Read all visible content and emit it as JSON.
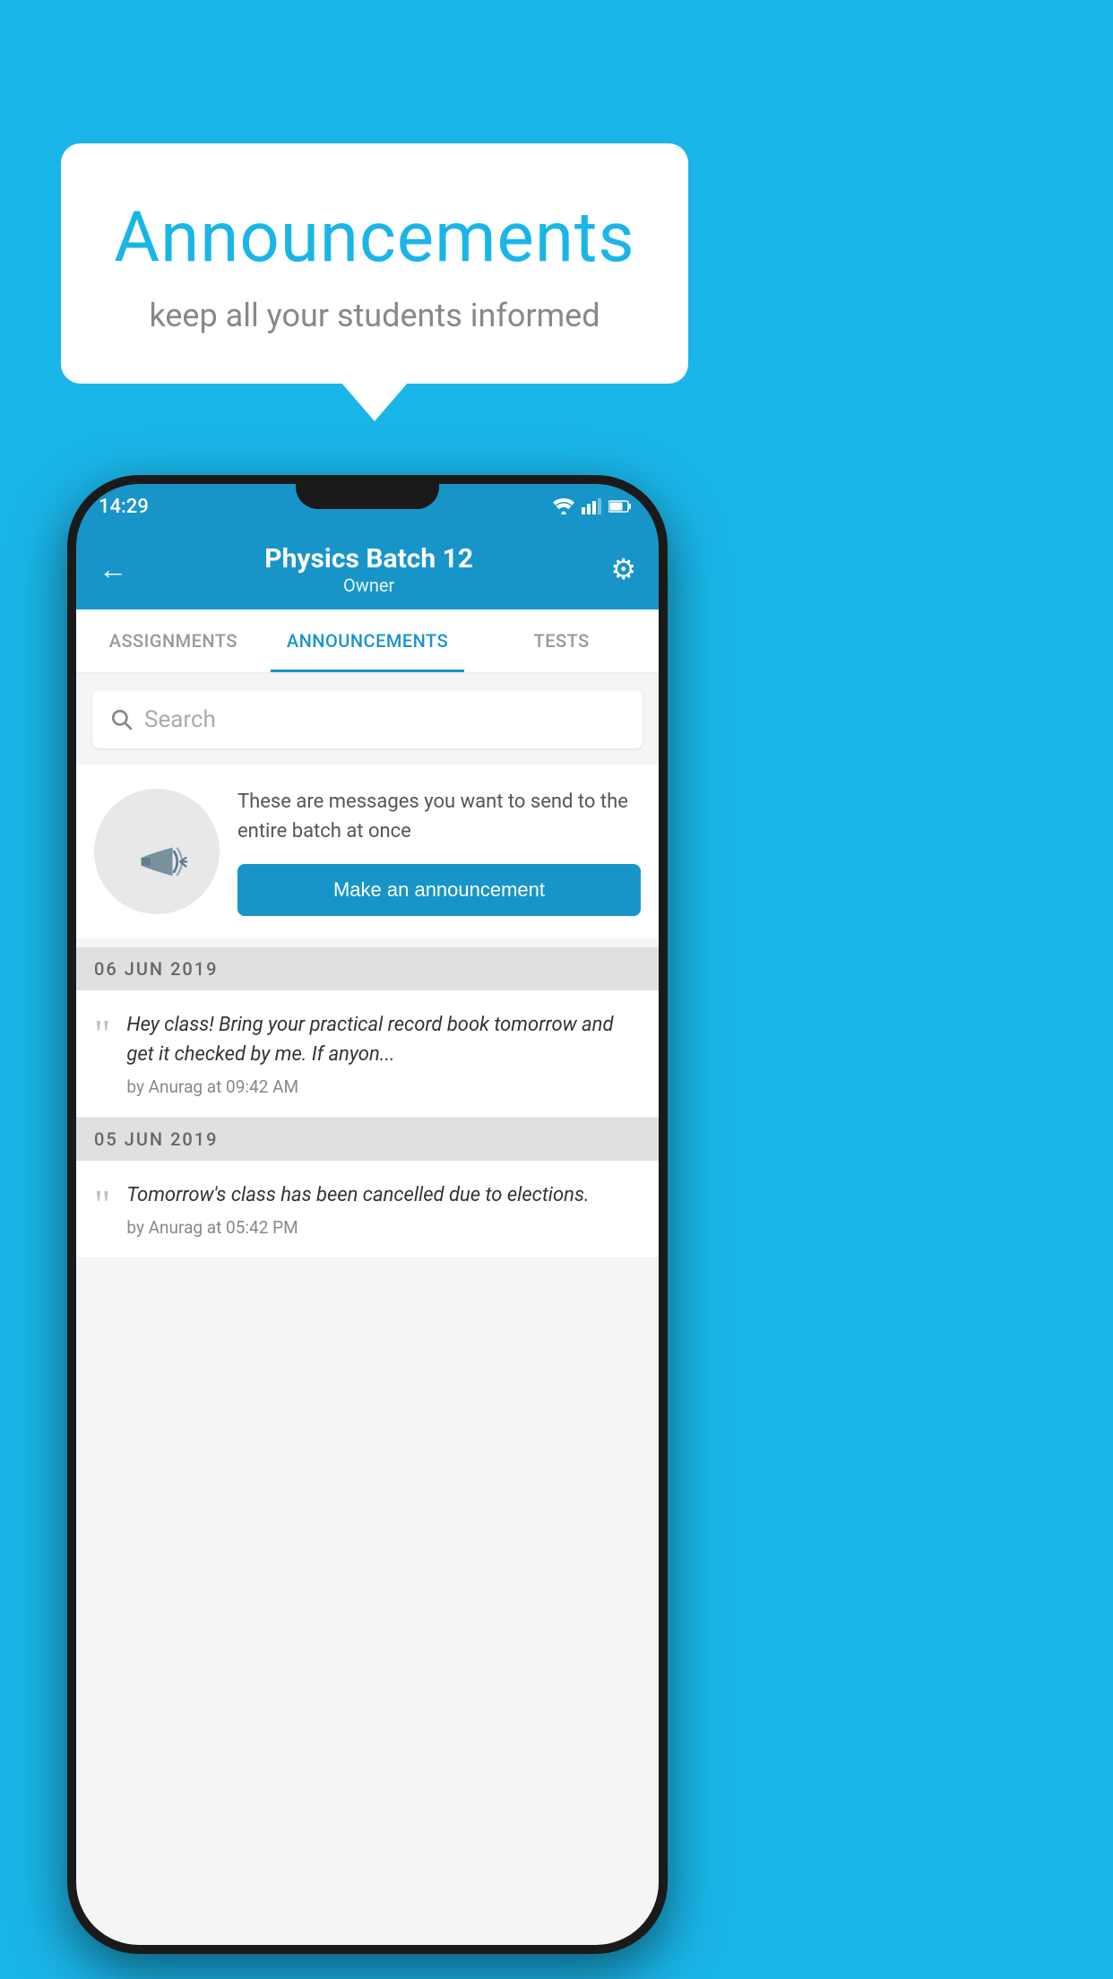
{
  "background_color": "#1ab5e8",
  "speech_bubble": {
    "title": "Announcements",
    "subtitle": "keep all your students informed"
  },
  "phone": {
    "status_bar": {
      "time": "14:29"
    },
    "app_bar": {
      "title": "Physics Batch 12",
      "subtitle": "Owner",
      "back_label": "←",
      "gear_label": "⚙"
    },
    "tabs": [
      {
        "label": "ASSIGNMENTS",
        "active": false
      },
      {
        "label": "ANNOUNCEMENTS",
        "active": true
      },
      {
        "label": "TESTS",
        "active": false
      }
    ],
    "search": {
      "placeholder": "Search"
    },
    "promo_section": {
      "description": "These are messages you want to send to the entire batch at once",
      "button_label": "Make an announcement"
    },
    "announcements": [
      {
        "date": "06  JUN  2019",
        "text": "Hey class! Bring your practical record book tomorrow and get it checked by me. If anyon...",
        "meta": "by Anurag at 09:42 AM"
      },
      {
        "date": "05  JUN  2019",
        "text": "Tomorrow's class has been cancelled due to elections.",
        "meta": "by Anurag at 05:42 PM"
      }
    ]
  }
}
